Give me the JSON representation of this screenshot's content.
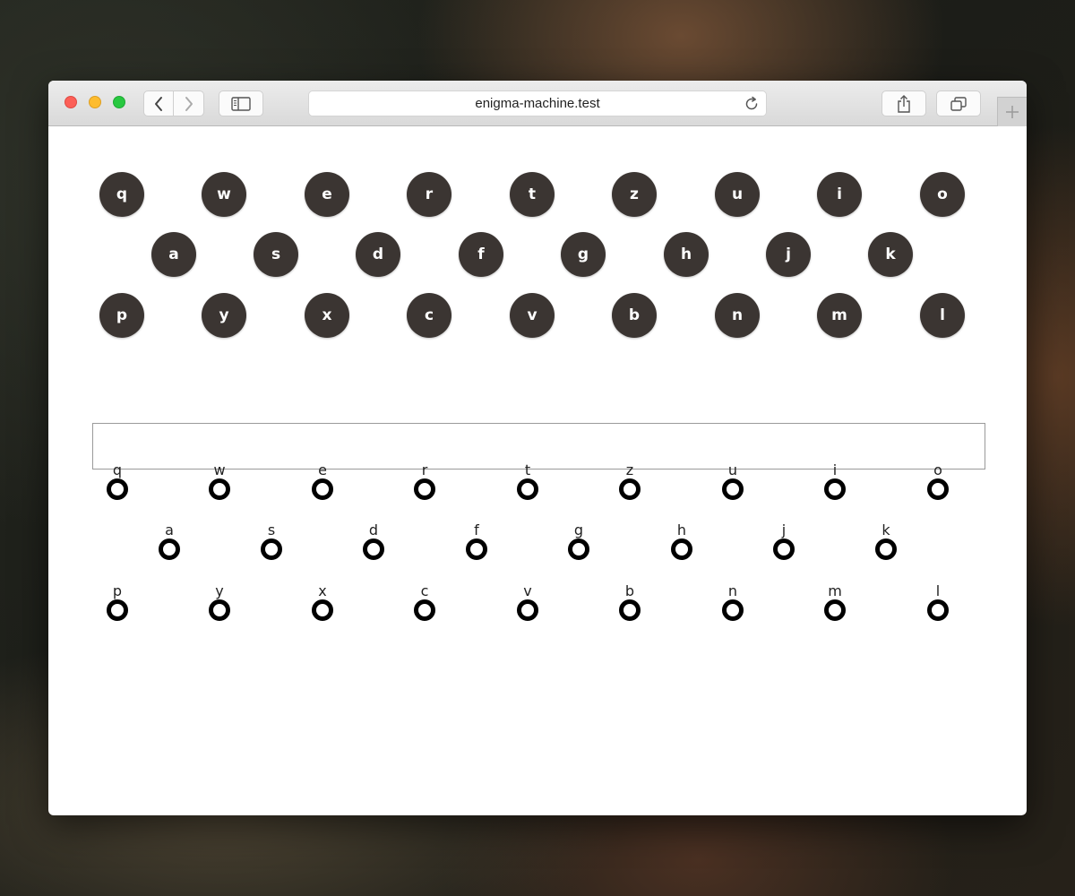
{
  "browser": {
    "url": "enigma-machine.test",
    "icons": {
      "back": "chevron-left-icon",
      "forward": "chevron-right-icon",
      "sidebar": "sidebar-icon",
      "reload": "reload-icon",
      "share": "share-icon",
      "tabs": "tabs-icon",
      "new_tab": "plus-icon"
    }
  },
  "keyboard": {
    "rows": [
      [
        "q",
        "w",
        "e",
        "r",
        "t",
        "z",
        "u",
        "i",
        "o"
      ],
      [
        "a",
        "s",
        "d",
        "f",
        "g",
        "h",
        "j",
        "k"
      ],
      [
        "p",
        "y",
        "x",
        "c",
        "v",
        "b",
        "n",
        "m",
        "l"
      ]
    ],
    "key_color": "#3b3532",
    "key_text_color": "#ffffff"
  },
  "output": {
    "value": "",
    "placeholder": ""
  },
  "lampboard": {
    "rows": [
      [
        "q",
        "w",
        "e",
        "r",
        "t",
        "z",
        "u",
        "i",
        "o"
      ],
      [
        "a",
        "s",
        "d",
        "f",
        "g",
        "h",
        "j",
        "k"
      ],
      [
        "p",
        "y",
        "x",
        "c",
        "v",
        "b",
        "n",
        "m",
        "l"
      ]
    ],
    "ring_color": "#000000"
  }
}
